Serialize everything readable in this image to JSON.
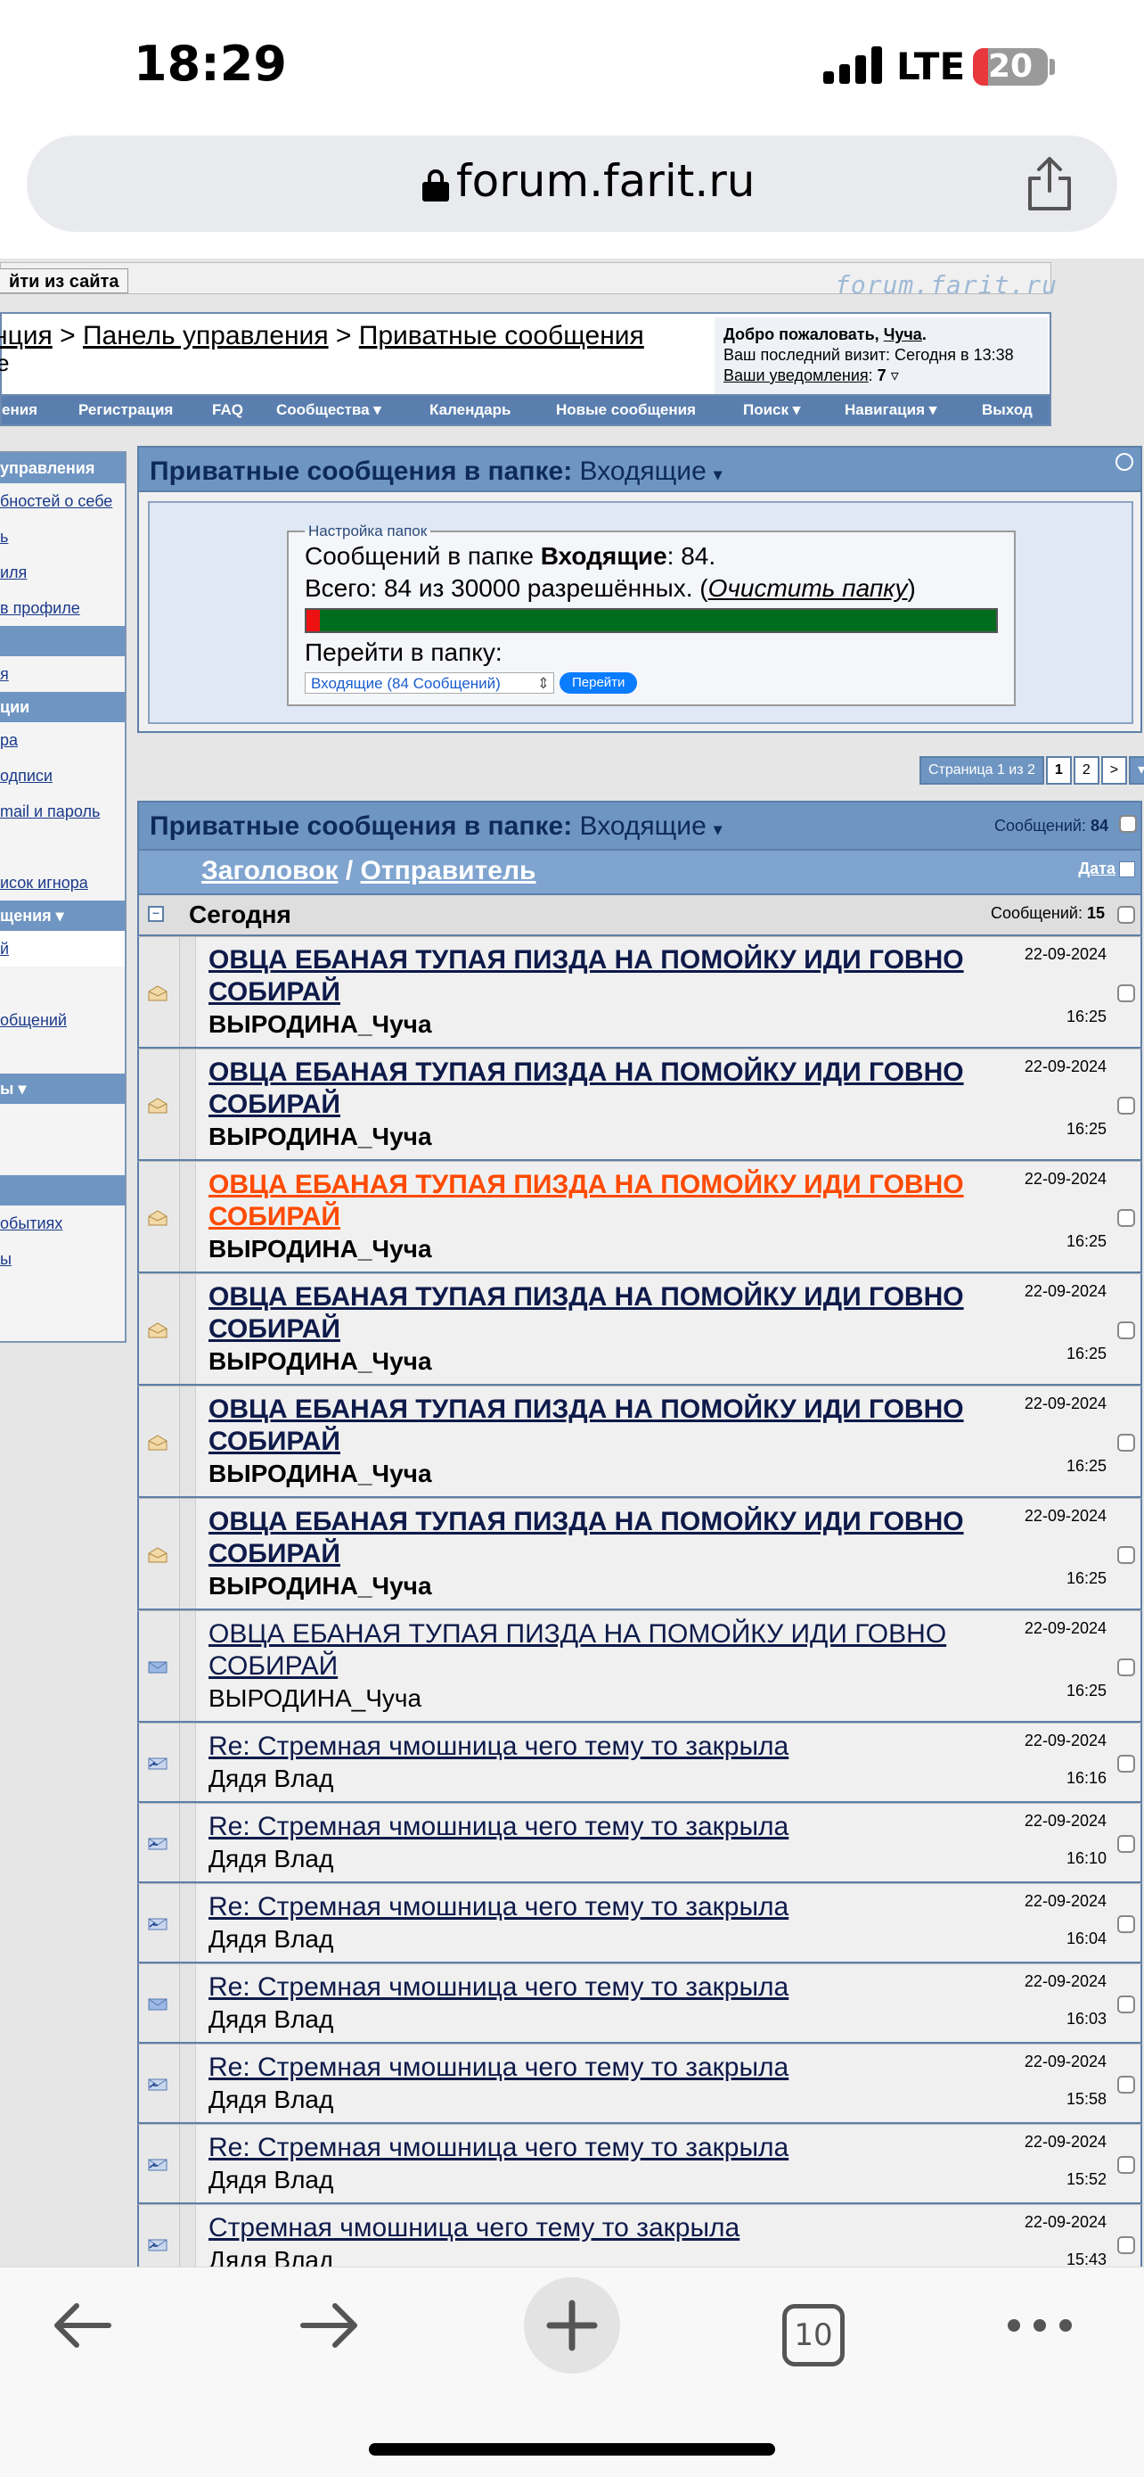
{
  "status_bar": {
    "time": "18:29",
    "network": "LTE",
    "battery": "20",
    "battery_level": 0.2
  },
  "browser": {
    "domain": "forum.farit.ru",
    "tabs_count": "10"
  },
  "site": {
    "logout_label": "йти из сайта",
    "logo": "forum.farit.ru",
    "breadcrumb": {
      "first": "нция",
      "sep1": " > ",
      "second": "Панель управления",
      "sep2": " > ",
      "third": "Приватные сообщения",
      "extra": "е"
    },
    "welcome": {
      "prefix": "Добро пожаловать, ",
      "user": "Чуча",
      "suffix": ".",
      "last_visit": "Ваш последний визит: Сегодня в 13:38",
      "notif_label": "Ваши уведомления",
      "notif_sep": ": ",
      "notif_count": "7"
    },
    "nav": [
      "ения",
      "Регистрация",
      "FAQ",
      "Сообщества ▾",
      "Календарь",
      "Новые сообщения",
      "Поиск ▾",
      "Навигация ▾",
      "Выход"
    ]
  },
  "sidebar": {
    "items": [
      {
        "label": "управления",
        "kind": "head"
      },
      {
        "label": "бностей о себе",
        "kind": "link"
      },
      {
        "label": "ь",
        "kind": "link"
      },
      {
        "label": "иля",
        "kind": "link"
      },
      {
        "label": "в профиле",
        "kind": "link"
      },
      {
        "label": "",
        "kind": "head"
      },
      {
        "label": "я",
        "kind": "link"
      },
      {
        "label": "ции",
        "kind": "head"
      },
      {
        "label": "ра",
        "kind": "link"
      },
      {
        "label": "одписи",
        "kind": "link"
      },
      {
        "label": "mail и пароль",
        "kind": "link"
      },
      {
        "label": "",
        "kind": "link"
      },
      {
        "label": "исок игнора",
        "kind": "link"
      },
      {
        "label": "щения ▾",
        "kind": "head"
      },
      {
        "label": "й",
        "kind": "sel"
      },
      {
        "label": "",
        "kind": "link"
      },
      {
        "label": "общений",
        "kind": "link"
      },
      {
        "label": "",
        "kind": "link"
      },
      {
        "label": "ы ▾",
        "kind": "head"
      },
      {
        "label": "",
        "kind": "link"
      },
      {
        "label": "",
        "kind": "link"
      },
      {
        "label": "",
        "kind": "head"
      },
      {
        "label": "обытиях",
        "kind": "link"
      },
      {
        "label": "ы",
        "kind": "link"
      }
    ]
  },
  "folder_panel": {
    "title": "Приватные сообщения в папке",
    "folder": "Входящие",
    "legend": "Настройка папок",
    "line1_prefix": "Сообщений в папке ",
    "line1_folder": "Входящие",
    "line1_suffix": ": 84.",
    "line2_prefix": "Всего: 84 из 30000 разрешённых. (",
    "clear_link": "Очистить папку",
    "line2_suffix": ")",
    "usage_fraction": 0.0028,
    "goto_label": "Перейти в папку:",
    "select_value": "Входящие (84 Сообщений)",
    "go_button": "Перейти"
  },
  "pager": {
    "label": "Страница 1 из 2",
    "current": "1",
    "page2": "2",
    "next": ">",
    "menu": "▾"
  },
  "list": {
    "title": "Приватные сообщения в папке",
    "folder": "Входящие",
    "count_label": "Сообщений:",
    "count": "84",
    "col_title": "Заголовок",
    "col_sep": " / ",
    "col_sender": "Отправитель",
    "col_date": "Дата",
    "group_name": "Сегодня",
    "group_count_label": "Сообщений:",
    "group_count": "15",
    "messages": [
      {
        "subject": "ОВЦА ЕБАНАЯ ТУПАЯ ПИЗДА НА ПОМОЙКУ ИДИ ГОВНО СОБИРАЙ",
        "sender": "ВЫРОДИНА_Чуча",
        "date": "22-09-2024",
        "time": "16:25",
        "unread": true,
        "hot": false,
        "icon": "read-envelope-icon"
      },
      {
        "subject": "ОВЦА ЕБАНАЯ ТУПАЯ ПИЗДА НА ПОМОЙКУ ИДИ ГОВНО СОБИРАЙ",
        "sender": "ВЫРОДИНА_Чуча",
        "date": "22-09-2024",
        "time": "16:25",
        "unread": true,
        "hot": false,
        "icon": "read-envelope-icon"
      },
      {
        "subject": "ОВЦА ЕБАНАЯ ТУПАЯ ПИЗДА НА ПОМОЙКУ ИДИ ГОВНО СОБИРАЙ",
        "sender": "ВЫРОДИНА_Чуча",
        "date": "22-09-2024",
        "time": "16:25",
        "unread": true,
        "hot": true,
        "icon": "read-envelope-icon"
      },
      {
        "subject": "ОВЦА ЕБАНАЯ ТУПАЯ ПИЗДА НА ПОМОЙКУ ИДИ ГОВНО СОБИРАЙ",
        "sender": "ВЫРОДИНА_Чуча",
        "date": "22-09-2024",
        "time": "16:25",
        "unread": true,
        "hot": false,
        "icon": "read-envelope-icon"
      },
      {
        "subject": "ОВЦА ЕБАНАЯ ТУПАЯ ПИЗДА НА ПОМОЙКУ ИДИ ГОВНО СОБИРАЙ",
        "sender": "ВЫРОДИНА_Чуча",
        "date": "22-09-2024",
        "time": "16:25",
        "unread": true,
        "hot": false,
        "icon": "read-envelope-icon"
      },
      {
        "subject": "ОВЦА ЕБАНАЯ ТУПАЯ ПИЗДА НА ПОМОЙКУ ИДИ ГОВНО СОБИРАЙ",
        "sender": "ВЫРОДИНА_Чуча",
        "date": "22-09-2024",
        "time": "16:25",
        "unread": true,
        "hot": false,
        "icon": "read-envelope-icon"
      },
      {
        "subject": "ОВЦА ЕБАНАЯ ТУПАЯ ПИЗДА НА ПОМОЙКУ ИДИ ГОВНО СОБИРАЙ",
        "sender": "ВЫРОДИНА_Чуча",
        "date": "22-09-2024",
        "time": "16:25",
        "unread": false,
        "hot": false,
        "icon": "closed-envelope-icon"
      },
      {
        "subject": "Re: Стремная чмошница чего тему то закрыла",
        "sender": "Дядя Влад",
        "date": "22-09-2024",
        "time": "16:16",
        "unread": false,
        "hot": false,
        "icon": "replied-envelope-icon"
      },
      {
        "subject": "Re: Стремная чмошница чего тему то закрыла",
        "sender": "Дядя Влад",
        "date": "22-09-2024",
        "time": "16:10",
        "unread": false,
        "hot": false,
        "icon": "replied-envelope-icon"
      },
      {
        "subject": "Re: Стремная чмошница чего тему то закрыла",
        "sender": "Дядя Влад",
        "date": "22-09-2024",
        "time": "16:04",
        "unread": false,
        "hot": false,
        "icon": "replied-envelope-icon"
      },
      {
        "subject": "Re: Стремная чмошница чего тему то закрыла",
        "sender": "Дядя Влад",
        "date": "22-09-2024",
        "time": "16:03",
        "unread": false,
        "hot": false,
        "icon": "closed-envelope-icon"
      },
      {
        "subject": "Re: Стремная чмошница чего тему то закрыла",
        "sender": "Дядя Влад",
        "date": "22-09-2024",
        "time": "15:58",
        "unread": false,
        "hot": false,
        "icon": "replied-envelope-icon"
      },
      {
        "subject": "Re: Стремная чмошница чего тему то закрыла",
        "sender": "Дядя Влад",
        "date": "22-09-2024",
        "time": "15:52",
        "unread": false,
        "hot": false,
        "icon": "replied-envelope-icon"
      },
      {
        "subject": "Стремная чмошница чего тему то закрыла",
        "sender": "Дядя Влад",
        "date": "22-09-2024",
        "time": "15:43",
        "unread": false,
        "hot": false,
        "icon": "replied-envelope-icon"
      }
    ]
  },
  "colors": {
    "accent_blue": "#6f95c2",
    "hot_link": "#ff4a00",
    "progress_used": "#ee1111",
    "progress_free": "#006d1e"
  }
}
